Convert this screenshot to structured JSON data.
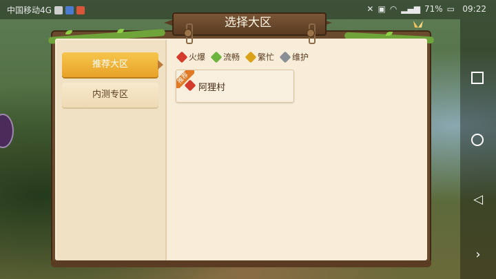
{
  "status_bar": {
    "carrier": "中国移动4G",
    "battery": "71%",
    "time": "09:22"
  },
  "dialog": {
    "title": "选择大区"
  },
  "tabs": [
    {
      "label": "推荐大区",
      "active": true
    },
    {
      "label": "内测专区",
      "active": false
    }
  ],
  "legend": [
    {
      "label": "火爆",
      "color": "#d33b2c"
    },
    {
      "label": "流畅",
      "color": "#6db33f"
    },
    {
      "label": "繁忙",
      "color": "#d9a21a"
    },
    {
      "label": "维护",
      "color": "#8a8f96"
    }
  ],
  "servers": [
    {
      "name": "阿狸村",
      "badge": "推荐",
      "status_color": "#d33b2c"
    }
  ],
  "nav_icons": [
    "square-icon",
    "circle-icon",
    "back-triangle-icon",
    "chevron-right-icon"
  ]
}
